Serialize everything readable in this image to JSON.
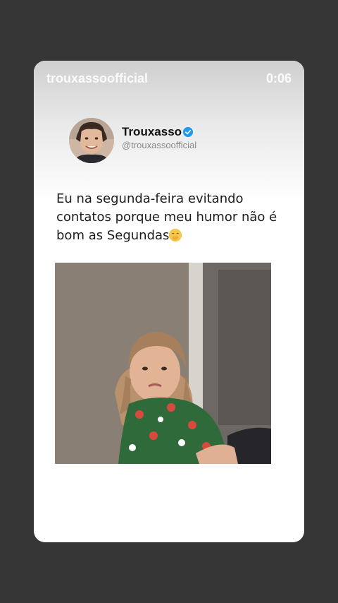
{
  "story": {
    "username": "trouxassoofficial",
    "timer": "0:06"
  },
  "tweet": {
    "display_name": "Trouxasso",
    "handle": "@trouxassoofficial",
    "text": "Eu na segunda-feira evitando contatos porque meu humor não é bom as Segundas",
    "emoji": "face-with-hand-over-mouth"
  },
  "colors": {
    "background": "#363636",
    "card": "#ffffff",
    "verified": "#1d9bf0"
  }
}
